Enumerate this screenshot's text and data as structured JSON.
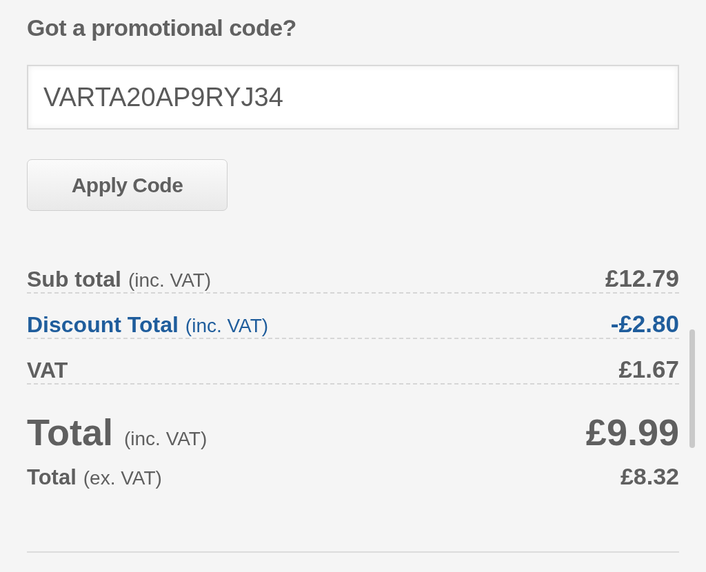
{
  "promo": {
    "title": "Got a promotional code?",
    "code_field": {
      "value": "VARTA20AP9RYJ34"
    },
    "apply_button": "Apply Code"
  },
  "summary": {
    "rows": [
      {
        "kind": "normal",
        "label": "Sub total",
        "note": "(inc. VAT)",
        "amount": "£12.79"
      },
      {
        "kind": "discount",
        "label": "Discount Total",
        "note": "(inc. VAT)",
        "amount": "-£2.80"
      },
      {
        "kind": "normal",
        "label": "VAT",
        "amount": "£1.67"
      },
      {
        "kind": "grand",
        "label": "Total",
        "note": "(inc. VAT)",
        "amount": "£9.99"
      },
      {
        "kind": "minor",
        "label": "Total",
        "note": "(ex. VAT)",
        "amount": "£8.32"
      }
    ]
  }
}
